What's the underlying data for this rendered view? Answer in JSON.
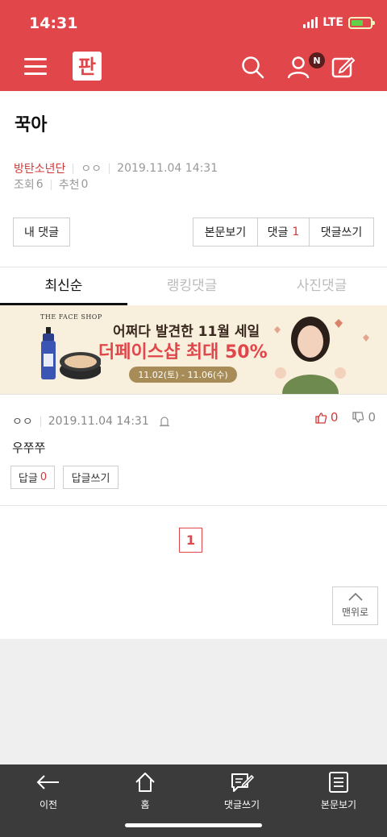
{
  "status_bar": {
    "time": "14:31",
    "network": "LTE"
  },
  "header": {
    "logo_text": "판",
    "notification_badge": "N",
    "icons": [
      "menu-icon",
      "search-icon",
      "user-icon",
      "write-icon"
    ]
  },
  "post": {
    "title": "꾹아",
    "board": "방탄소년단",
    "author": "ㅇㅇ",
    "datetime": "2019.11.04 14:31",
    "views_label": "조회",
    "views": "6",
    "recommend_label": "추천",
    "recommend": "0"
  },
  "actions": {
    "my_comments": "내 댓글",
    "view_post": "본문보기",
    "comments_label": "댓글",
    "comments_count": "1",
    "write_comment": "댓글쓰기"
  },
  "tabs": [
    {
      "label": "최신순",
      "active": true
    },
    {
      "label": "랭킹댓글",
      "active": false
    },
    {
      "label": "사진댓글",
      "active": false
    }
  ],
  "banner": {
    "brand": "THE FACE SHOP",
    "line1": "어쩌다 발견한 11월 세일",
    "line2": "더페이스샵 최대 50%",
    "dates": "11.02(토) - 11.06(수)"
  },
  "comment": {
    "author": "ㅇㅇ",
    "datetime": "2019.11.04 14:31",
    "likes": "0",
    "dislikes": "0",
    "body": "우쭈쭈",
    "reply_label": "답글",
    "reply_count": "0",
    "write_reply": "답글쓰기"
  },
  "pagination": {
    "current": "1"
  },
  "to_top": "맨위로",
  "bottom_nav": [
    {
      "label": "이전",
      "icon": "back-arrow-icon"
    },
    {
      "label": "홈",
      "icon": "home-icon"
    },
    {
      "label": "댓글쓰기",
      "icon": "comment-write-icon"
    },
    {
      "label": "본문보기",
      "icon": "document-icon"
    }
  ],
  "colors": {
    "brand_red": "#e0464a",
    "bottom_bar": "#3b3b3b"
  }
}
